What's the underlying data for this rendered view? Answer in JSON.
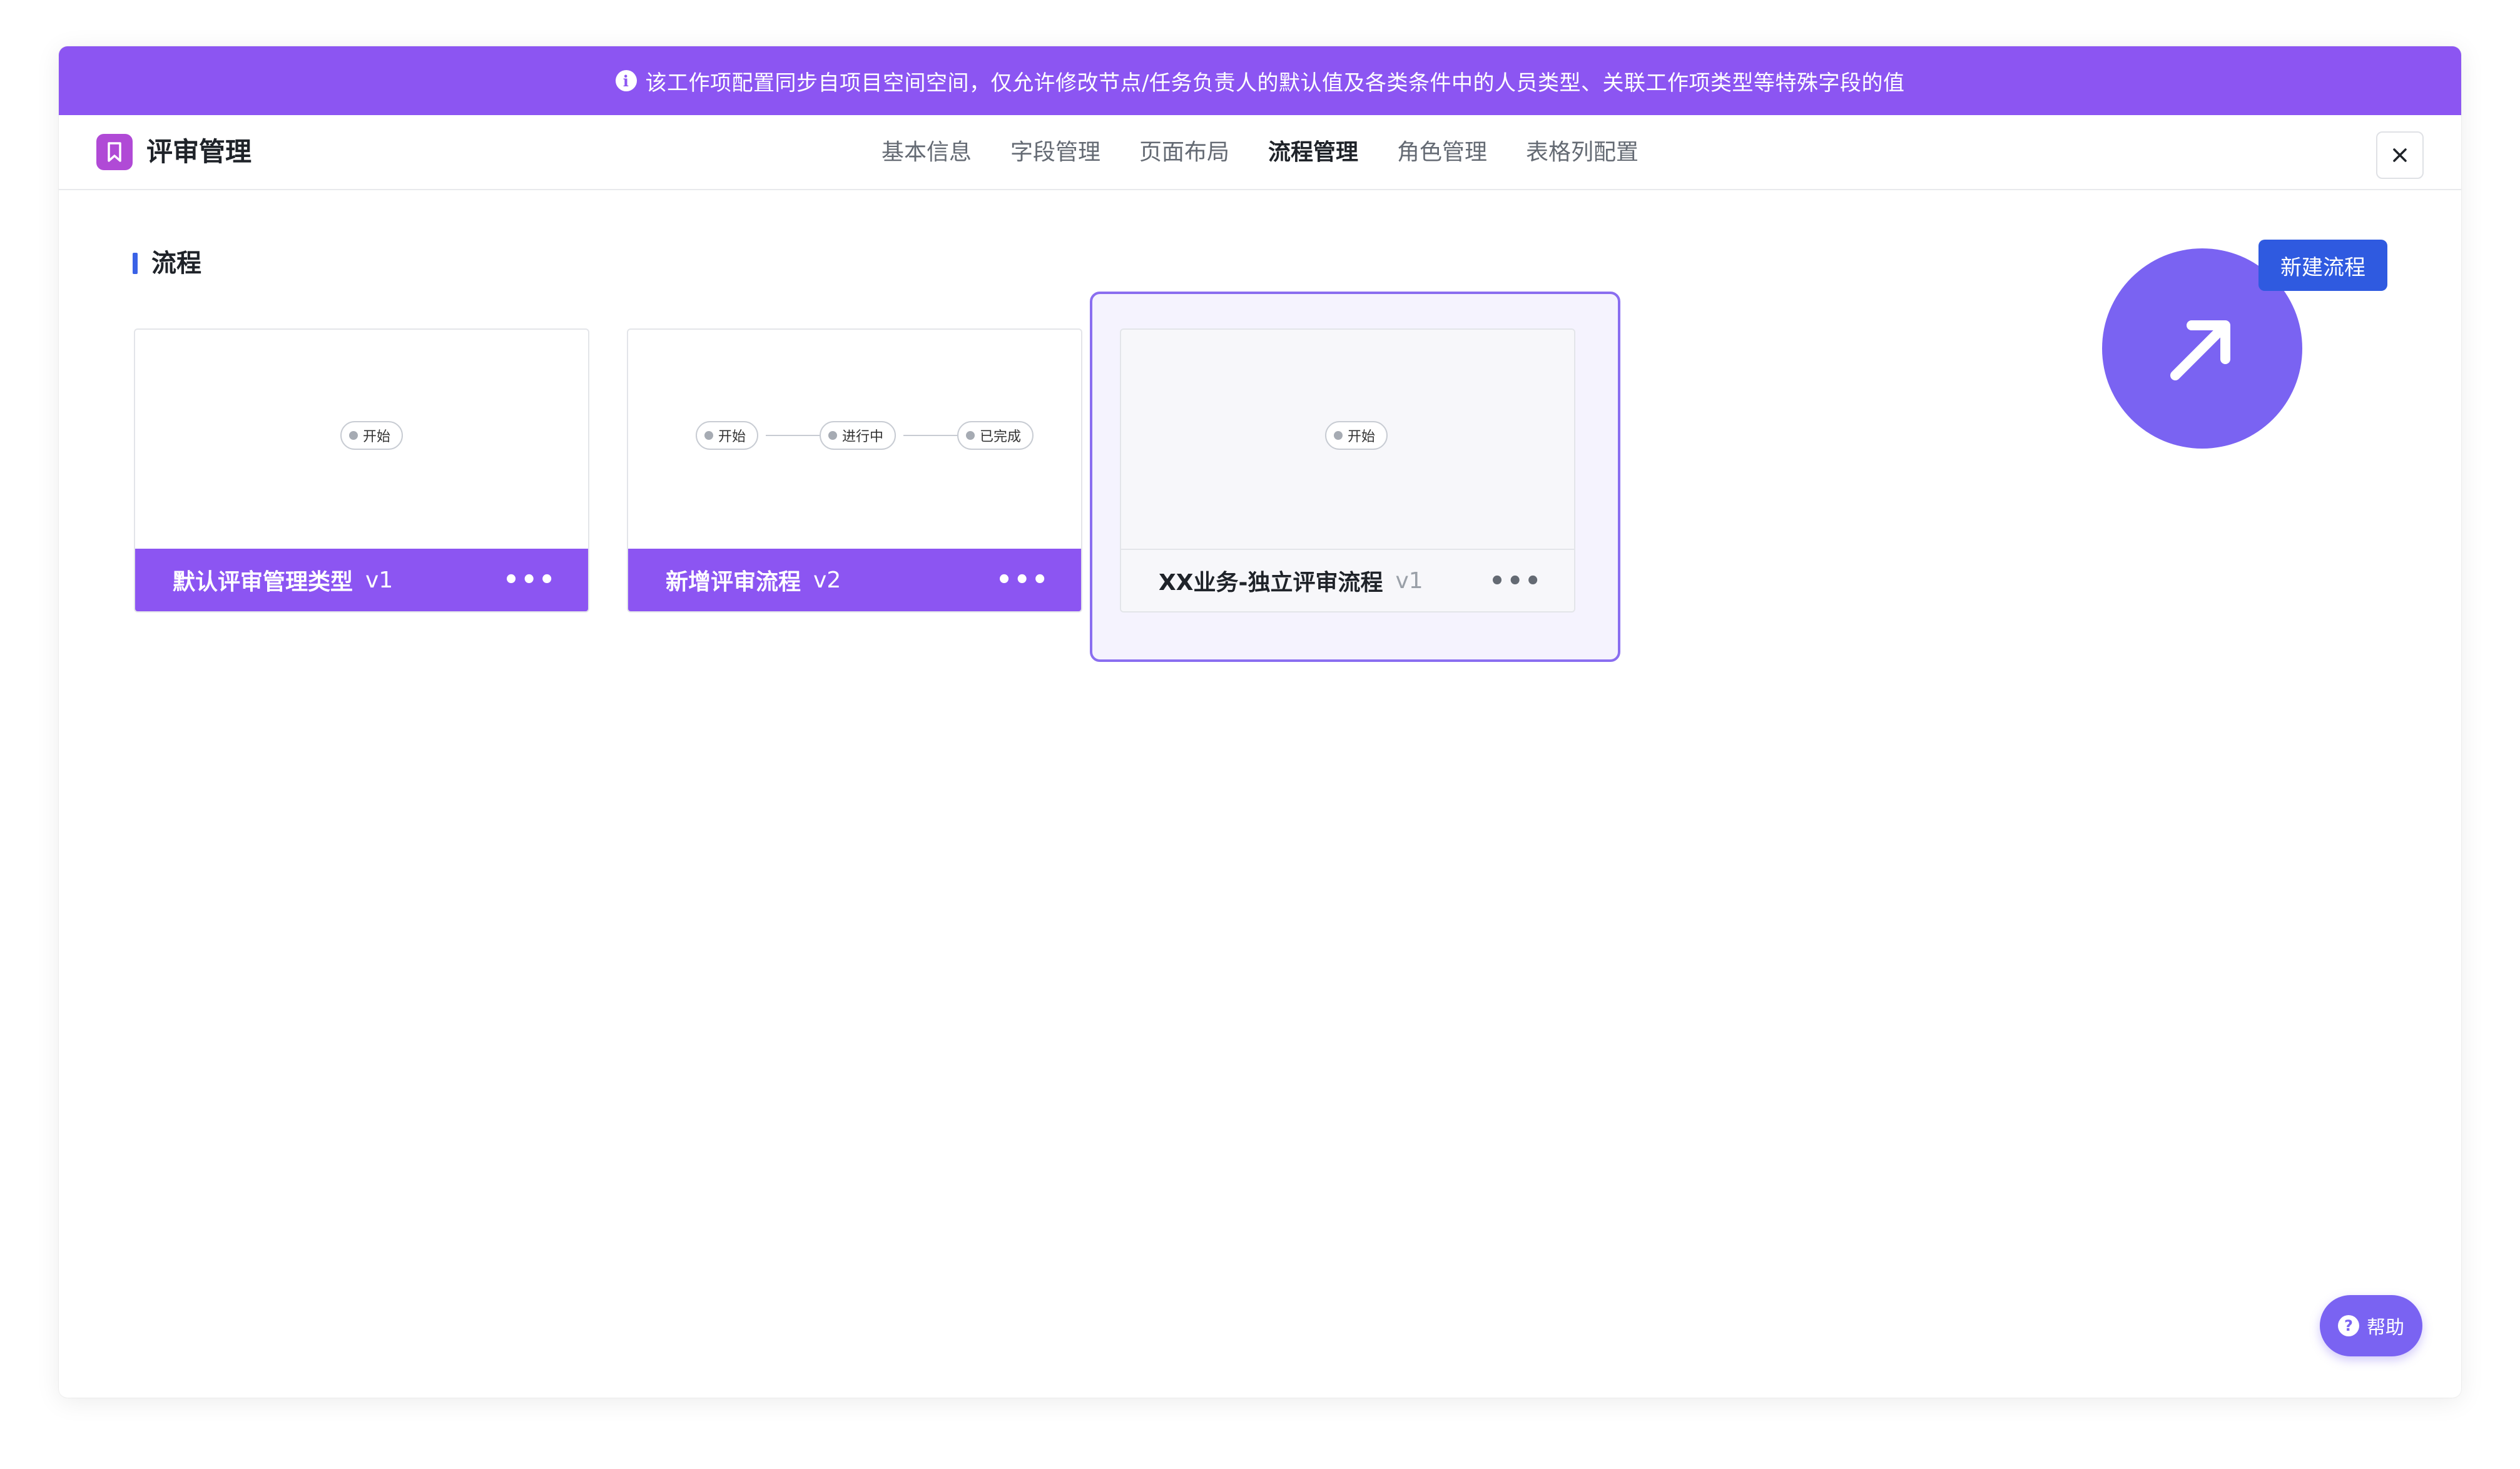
{
  "banner": {
    "message": "该工作项配置同步自项目空间空间，仅允许修改节点/任务负责人的默认值及各类条件中的人员类型、关联工作项类型等特殊字段的值"
  },
  "header": {
    "title": "评审管理",
    "tabs": [
      {
        "label": "基本信息",
        "active": false
      },
      {
        "label": "字段管理",
        "active": false
      },
      {
        "label": "页面布局",
        "active": false
      },
      {
        "label": "流程管理",
        "active": true
      },
      {
        "label": "角色管理",
        "active": false
      },
      {
        "label": "表格列配置",
        "active": false
      }
    ]
  },
  "section": {
    "title": "流程",
    "new_button": "新建流程"
  },
  "cards": [
    {
      "name": "默认评审管理类型",
      "version": "v1",
      "nodes": [
        "开始"
      ]
    },
    {
      "name": "新增评审流程",
      "version": "v2",
      "nodes": [
        "开始",
        "进行中",
        "已完成"
      ]
    },
    {
      "name": "XX业务-独立评审流程",
      "version": "v1",
      "nodes": [
        "开始"
      ],
      "selected": true
    }
  ],
  "help": {
    "label": "帮助"
  },
  "colors": {
    "accent": "#8c55f2",
    "primary_button": "#2f5ae0",
    "fab": "#7a63f2"
  }
}
